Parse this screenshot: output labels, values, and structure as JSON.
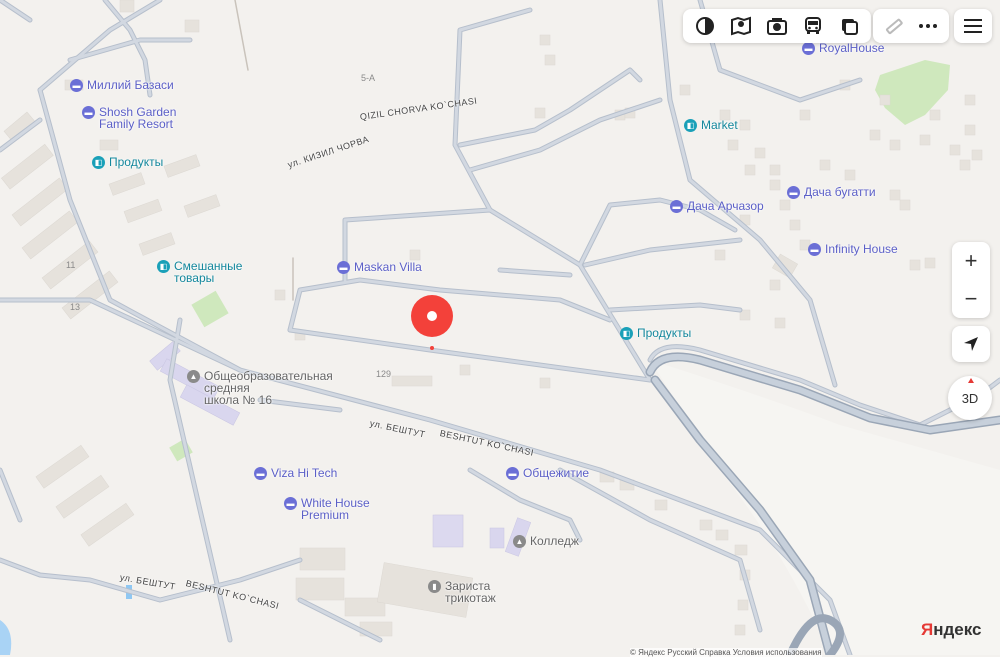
{
  "toolbar": {
    "main": [
      "layers-icon",
      "panorama-icon",
      "photo-icon",
      "transit-icon",
      "traffic-icon"
    ],
    "extra": [
      "ruler-icon",
      "more-icon"
    ]
  },
  "controls": {
    "zoom_in": "+",
    "zoom_out": "−",
    "three_d": "3D"
  },
  "brand": {
    "first": "Я",
    "rest": "ндекс"
  },
  "footer": "© Яндекс   Русский   Справка   Условия использования",
  "pois": [
    {
      "label": "Миллий Базаси",
      "kind": "hotel"
    },
    {
      "label": "Shosh Garden\nFamily Resort",
      "kind": "hotel"
    },
    {
      "label": "Продукты",
      "kind": "shop"
    },
    {
      "label": "Смешанные\nтовары",
      "kind": "shop"
    },
    {
      "label": "Maskan Villa",
      "kind": "hotel"
    },
    {
      "label": "Общеобразовательная\nсредняя\nшкола № 16",
      "kind": "edu"
    },
    {
      "label": "Viza Hi Tech",
      "kind": "hotel"
    },
    {
      "label": "White House\nPremium",
      "kind": "hotel"
    },
    {
      "label": "Общежитие",
      "kind": "hotel"
    },
    {
      "label": "Колледж",
      "kind": "edu"
    },
    {
      "label": "Зариста\nтрикотаж",
      "kind": "fab"
    },
    {
      "label": "Market",
      "kind": "shop"
    },
    {
      "label": "Дача Арчазор",
      "kind": "hotel"
    },
    {
      "label": "Дача бугатти",
      "kind": "hotel"
    },
    {
      "label": "Infinity House",
      "kind": "hotel"
    },
    {
      "label": "Продукты",
      "kind": "shop"
    },
    {
      "label": "RoyalHouse",
      "kind": "hotel"
    }
  ],
  "house_numbers": [
    "5-А",
    "11",
    "13",
    "129"
  ],
  "streets": [
    "QIZIL CHORVA KO`CHASI",
    "ул. КИЗИЛ ЧОРВА",
    "ул. БЕШТУТ",
    "BESHTUT KO`CHASI",
    "ул. БЕШТУТ",
    "BESHTUT KO`CHASI"
  ]
}
